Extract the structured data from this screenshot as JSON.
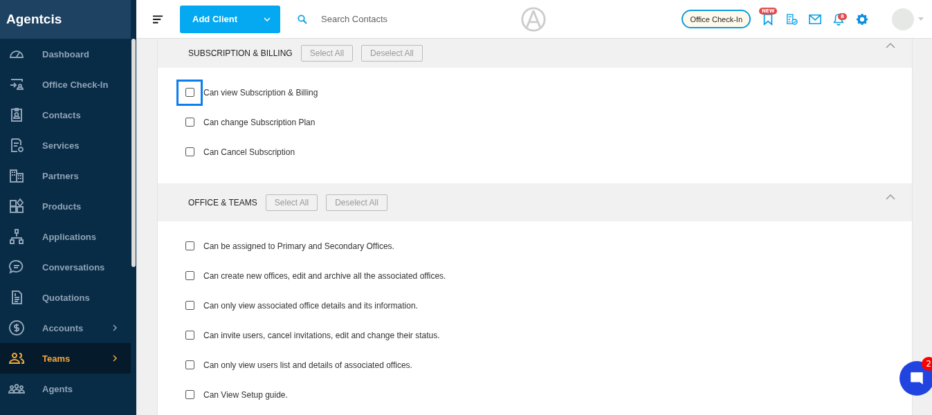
{
  "sidebar": {
    "logo": "Agentcis",
    "items": [
      {
        "label": "Dashboard",
        "selected": false,
        "has_submenu": false
      },
      {
        "label": "Office Check-In",
        "selected": false,
        "has_submenu": false
      },
      {
        "label": "Contacts",
        "selected": false,
        "has_submenu": false
      },
      {
        "label": "Services",
        "selected": false,
        "has_submenu": false
      },
      {
        "label": "Partners",
        "selected": false,
        "has_submenu": false
      },
      {
        "label": "Products",
        "selected": false,
        "has_submenu": false
      },
      {
        "label": "Applications",
        "selected": false,
        "has_submenu": false
      },
      {
        "label": "Conversations",
        "selected": false,
        "has_submenu": false
      },
      {
        "label": "Quotations",
        "selected": false,
        "has_submenu": false
      },
      {
        "label": "Accounts",
        "selected": false,
        "has_submenu": true
      },
      {
        "label": "Teams",
        "selected": true,
        "has_submenu": true
      },
      {
        "label": "Agents",
        "selected": false,
        "has_submenu": false
      }
    ]
  },
  "topbar": {
    "add_button": "Add Client",
    "search": {
      "placeholder": "Search Contacts"
    },
    "checkin_button": "Office Check-In",
    "new_badge": "NEW",
    "notification_count": "8"
  },
  "sections": [
    {
      "title": "SUBSCRIPTION & BILLING",
      "select_all": "Select All",
      "deselect_all": "Deselect All",
      "expanded": true,
      "permissions": [
        {
          "label": "Can view Subscription & Billing",
          "checked": false,
          "focused": true
        },
        {
          "label": "Can change Subscription Plan",
          "checked": false,
          "focused": false
        },
        {
          "label": "Can Cancel Subscription",
          "checked": false,
          "focused": false
        }
      ]
    },
    {
      "title": "OFFICE & TEAMS",
      "select_all": "Select All",
      "deselect_all": "Deselect All",
      "expanded": true,
      "permissions": [
        {
          "label": "Can be assigned to Primary and Secondary Offices.",
          "checked": false,
          "focused": false
        },
        {
          "label": "Can create new offices, edit and archive all the associated offices.",
          "checked": false,
          "focused": false
        },
        {
          "label": "Can only view associated office details and its information.",
          "checked": false,
          "focused": false
        },
        {
          "label": "Can invite users, cancel invitations, edit and change their status.",
          "checked": false,
          "focused": false
        },
        {
          "label": "Can only view users list and details of associated offices.",
          "checked": false,
          "focused": false
        },
        {
          "label": "Can View Setup guide.",
          "checked": false,
          "focused": false
        }
      ]
    }
  ],
  "chat_widget": {
    "badge": "2"
  }
}
